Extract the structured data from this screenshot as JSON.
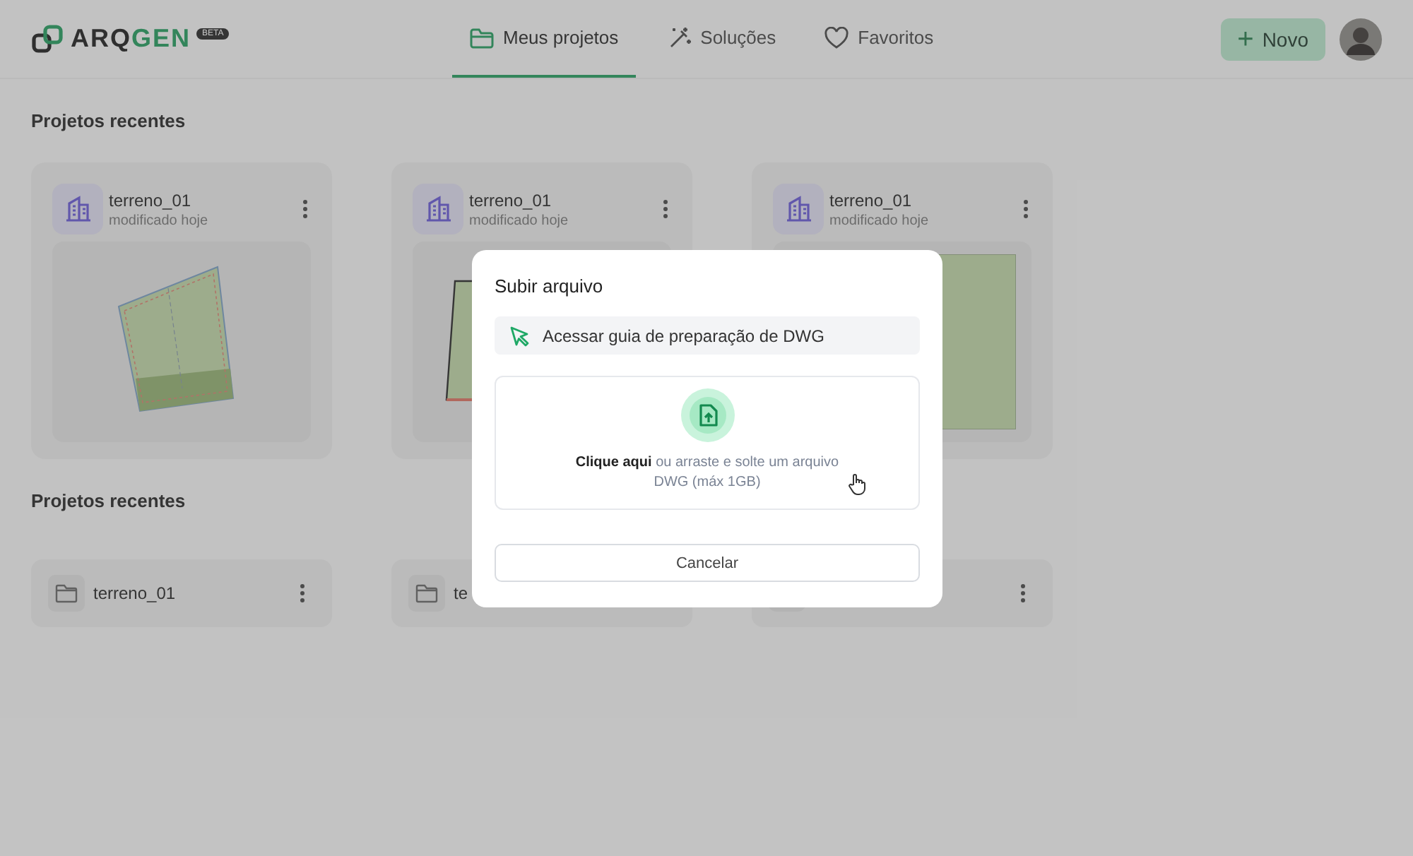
{
  "header": {
    "logo": {
      "text_dark": "ARQ",
      "text_accent": "GEN",
      "badge": "BETA"
    },
    "tabs": [
      {
        "label": "Meus projetos",
        "selected": true
      },
      {
        "label": "Soluções",
        "selected": false
      },
      {
        "label": "Favoritos",
        "selected": false
      }
    ],
    "new_button": {
      "icon": "+",
      "label": "Novo"
    }
  },
  "recent_projects": {
    "title": "Projetos recentes",
    "cards": [
      {
        "name": "terreno_01",
        "modified": "modificado hoje",
        "kind": "tilted"
      },
      {
        "name": "terreno_01",
        "modified": "modificado hoje",
        "kind": "trapezoid"
      },
      {
        "name": "terreno_01",
        "modified": "modificado hoje",
        "kind": "rectangle"
      }
    ]
  },
  "recent_folders": {
    "title": "Projetos recentes",
    "items": [
      {
        "kind": "folder",
        "name": "terreno_01"
      },
      {
        "kind": "folder",
        "name": "te"
      },
      {
        "kind": "folder"
      }
    ]
  },
  "dialog": {
    "title": "Subir arquivo",
    "guide_link": "Acessar guia de preparação de DWG",
    "dropzone": {
      "text": "**Clique aqui** ou arraste e solte um arquivo DWG (máx 1GB)"
    },
    "cancel_button": "Cancelar"
  }
}
